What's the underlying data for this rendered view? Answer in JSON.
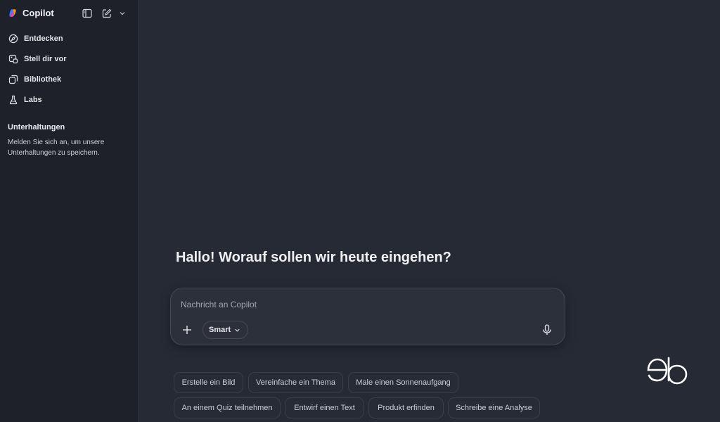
{
  "app": {
    "name": "Copilot"
  },
  "sidebar": {
    "nav": [
      {
        "label": "Entdecken",
        "icon": "compass-icon"
      },
      {
        "label": "Stell dir vor",
        "icon": "image-create-icon"
      },
      {
        "label": "Bibliothek",
        "icon": "library-icon"
      },
      {
        "label": "Labs",
        "icon": "flask-icon"
      }
    ],
    "conversations": {
      "title": "Unterhaltungen",
      "text": "Melden Sie sich an, um unsere Unterhaltungen zu speichern."
    }
  },
  "main": {
    "greeting": "Hallo! Worauf sollen wir heute eingehen?",
    "composer": {
      "placeholder": "Nachricht an Copilot",
      "value": "",
      "mode": "Smart"
    },
    "suggestions": [
      [
        "Erstelle ein Bild",
        "Vereinfache ein Thema",
        "Male einen Sonnenaufgang"
      ],
      [
        "An einem Quiz teilnehmen",
        "Entwirf einen Text",
        "Produkt erfinden",
        "Schreibe eine Analyse"
      ]
    ]
  },
  "colors": {
    "background": "#262a35",
    "sidebar": "#1e212a",
    "composer": "#2c303b",
    "text": "#e8e8ec"
  }
}
